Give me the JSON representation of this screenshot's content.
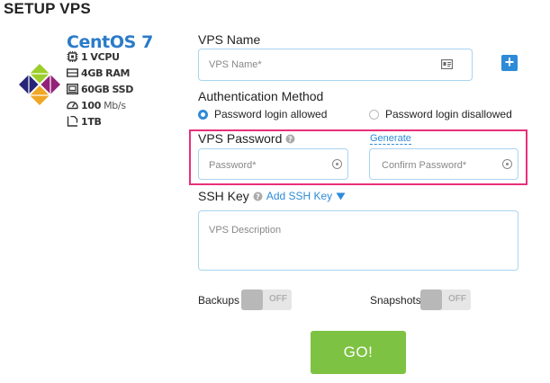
{
  "page": {
    "title": "SETUP VPS"
  },
  "product": {
    "os_name": "CentOS 7",
    "specs": [
      {
        "icon": "cpu-icon",
        "value": "1",
        "unit": "VCPU"
      },
      {
        "icon": "ram-icon",
        "value": "4GB",
        "unit": "RAM"
      },
      {
        "icon": "disk-icon",
        "value": "60GB",
        "unit": "SSD"
      },
      {
        "icon": "speed-gauge-icon",
        "value": "100",
        "unit": "Mb/s"
      },
      {
        "icon": "bandwidth-icon",
        "value": "1TB",
        "unit": ""
      }
    ]
  },
  "form": {
    "vps_name": {
      "label": "VPS Name",
      "placeholder": "VPS Name*"
    },
    "auth": {
      "label": "Authentication Method",
      "options": [
        {
          "label": "Password login allowed",
          "selected": true
        },
        {
          "label": "Password login disallowed",
          "selected": false
        }
      ]
    },
    "password": {
      "label": "VPS Password",
      "generate_link": "Generate",
      "password_placeholder": "Password*",
      "confirm_placeholder": "Confirm Password*"
    },
    "ssh": {
      "label": "SSH Key",
      "add_link": "Add SSH Key",
      "description_placeholder": "VPS Description"
    },
    "backups": {
      "label": "Backups",
      "state": "OFF"
    },
    "snapshots": {
      "label": "Snapshots",
      "state": "OFF"
    },
    "submit_label": "GO!"
  },
  "colors": {
    "accent": "#2e8bd8",
    "highlight": "#e8307a",
    "submit": "#7dc242",
    "input_border": "#a9d4f0"
  }
}
